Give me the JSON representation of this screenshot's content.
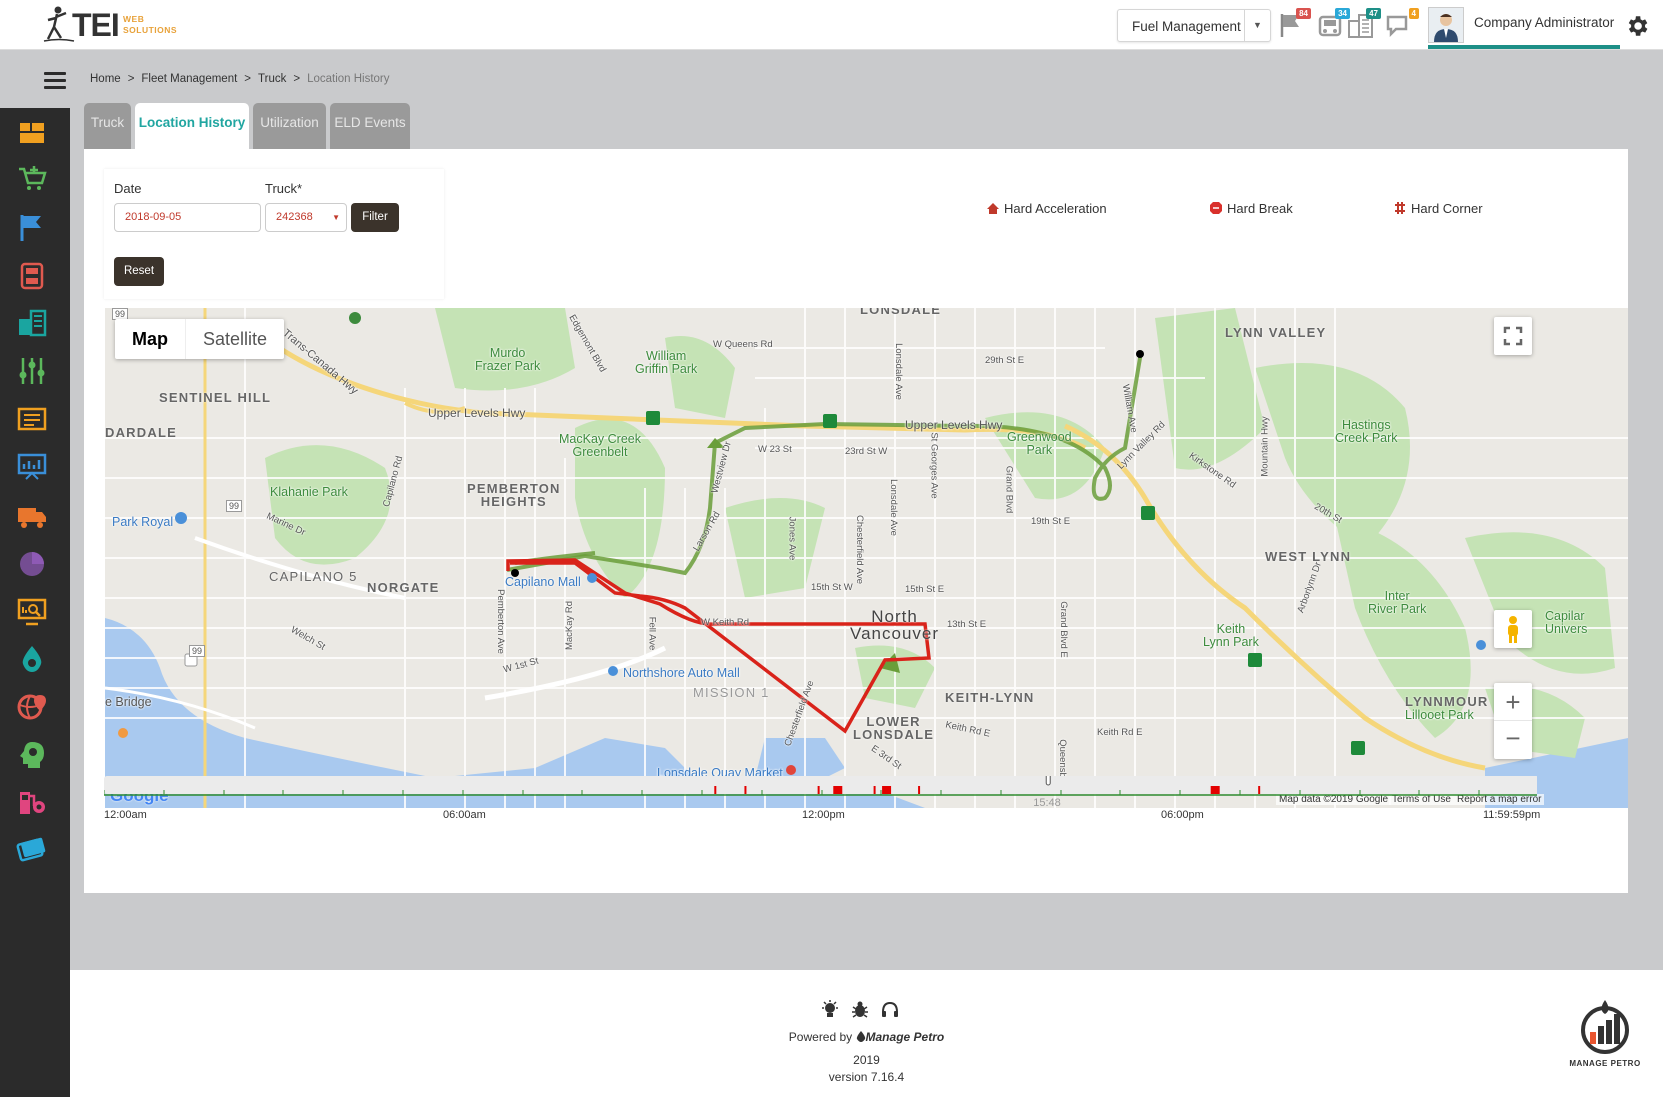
{
  "header": {
    "logo_main": "TEI",
    "logo_sub_1": "WEB",
    "logo_sub_2": "SOLUTIONS",
    "module_select": "Fuel Management",
    "notifications": [
      {
        "icon": "flag-icon",
        "count": "84",
        "color": "#d9534f"
      },
      {
        "icon": "fuel-pump-icon",
        "count": "34",
        "color": "#2aa8d8"
      },
      {
        "icon": "building-icon",
        "count": "47",
        "color": "#1d8f87"
      },
      {
        "icon": "chat-icon",
        "count": "4",
        "color": "#f0a020"
      }
    ],
    "user_name": "Company Administrator"
  },
  "sidebar": {
    "items": [
      {
        "icon": "dashboard-icon",
        "color": "#f0a020"
      },
      {
        "icon": "cart-icon",
        "color": "#5cb85c"
      },
      {
        "icon": "flag-icon",
        "color": "#3a8fd9"
      },
      {
        "icon": "fuel-station-icon",
        "color": "#e05a4f"
      },
      {
        "icon": "buildings-icon",
        "color": "#1aa5a0"
      },
      {
        "icon": "sliders-icon",
        "color": "#5cb85c"
      },
      {
        "icon": "report-icon",
        "color": "#f0a020"
      },
      {
        "icon": "presentation-chart-icon",
        "color": "#3a8fd9"
      },
      {
        "icon": "truck-icon",
        "color": "#e8762d"
      },
      {
        "icon": "pie-chart-icon",
        "color": "#8e5ab5"
      },
      {
        "icon": "monitor-search-icon",
        "color": "#f0a020"
      },
      {
        "icon": "water-drop-icon",
        "color": "#1aa5a0"
      },
      {
        "icon": "globe-pin-icon",
        "color": "#e05a4f"
      },
      {
        "icon": "gear-head-icon",
        "color": "#5cb85c"
      },
      {
        "icon": "pump-gear-icon",
        "color": "#e0457f"
      },
      {
        "icon": "card-icon",
        "color": "#2aa8d8"
      }
    ]
  },
  "breadcrumb": [
    "Home",
    "Fleet Management",
    "Truck",
    "Location History"
  ],
  "tabs": [
    {
      "label": "Truck",
      "active": false
    },
    {
      "label": "Location History",
      "active": true
    },
    {
      "label": "Utilization",
      "active": false
    },
    {
      "label": "ELD Events",
      "active": false
    }
  ],
  "filter": {
    "date_label": "Date",
    "date_value": "2018-09-05",
    "truck_label": "Truck*",
    "truck_value": "242368",
    "filter_button": "Filter",
    "reset_button": "Reset"
  },
  "legend": {
    "hard_acceleration": "Hard Acceleration",
    "hard_break": "Hard Break",
    "hard_corner": "Hard Corner"
  },
  "map": {
    "type_map": "Map",
    "type_satellite": "Satellite",
    "attribution": "Map data ©2019 Google",
    "terms": "Terms of Use",
    "report": "Report a map error",
    "google": "Google",
    "labels": {
      "lonsdale_top": "LONSDALE",
      "lynn_valley": "LYNN VALLEY",
      "sentinel_hill": "SENTINEL HILL",
      "ardale": "DARDALE",
      "pemberton_heights": "PEMBERTON\nHEIGHTS",
      "capilano5": "CAPILANO 5",
      "norgate": "NORGATE",
      "west_lynn": "WEST LYNN",
      "mission": "MISSION 1",
      "keith_lynn": "KEITH-LYNN",
      "lower_lonsdale": "LOWER\nLONSDALE",
      "lynnmour": "LYNNMOUR",
      "north_vancouver": "North\nVancouver",
      "murdo": "Murdo\nFrazer Park",
      "william": "William\nGriffin Park",
      "mackay": "MacKay Creek\nGreenbelt",
      "klahanie": "Klahanie Park",
      "greenwood": "Greenwood\nPark",
      "hastings": "Hastings\nCreek Park",
      "inter_river": "Inter\nRiver Park",
      "keith_lynn_park": "Keith\nLynn Park",
      "lillooet": "Lillooet Park",
      "capilano_univ": "Capilar\nUnivers",
      "park_royal": "Park Royal",
      "capilano_mall": "Capilano Mall",
      "northshore": "Northshore Auto Mall",
      "lonsdale_quay": "Lonsdale Quay Market",
      "bridge": "e Bridge",
      "upper_levels": "Upper Levels Hwy",
      "upper_levels_2": "Upper Levels Hwy",
      "trans_canada": "Trans-Canada Hwy",
      "w_queens": "W Queens Rd",
      "w23": "W 23 St",
      "e23": "23rd St W",
      "e29": "29th St E",
      "e19": "19th St E",
      "e20": "20th St",
      "w15": "15th St W",
      "e15": "15th St E",
      "e13": "13th St E",
      "keith_rd": "Keith Rd E",
      "keith_rd2": "Keith Rd E",
      "w1st": "W 1st St",
      "e3rd": "E 3rd St",
      "marine": "Marine Dr",
      "welch": "Welch St",
      "kirkstone": "Kirkstone Rd",
      "lynn_valley_rd": "Lynn Valley Rd",
      "capilano_rd": "Capilano Rd",
      "pemberton_ave": "Pemberton Ave",
      "mackay_rd": "MacKay Rd",
      "fell": "Fell Ave",
      "jones": "Jones Ave",
      "chesterfield": "Chesterfield Ave",
      "chesterfield2": "Chesterfield Ave",
      "lonsdale_ave": "Lonsdale Ave",
      "lonsdale_ave2": "Lonsdale Ave",
      "st_georges": "St Georges Ave",
      "grand_blvd": "Grand Blvd",
      "grand_blvd_e": "Grand Blvd E",
      "william_ave": "William Ave",
      "mountain_hwy": "Mountain Hwy",
      "arborlynn": "Arborlynn Dr",
      "larson": "Larson Rd",
      "westview": "Westview Dr",
      "edgemont": "Edgemont Blvd",
      "queensbury": "Queensb",
      "w_keith": "W Keith Rd",
      "hwy99a": "99",
      "hwy99b": "99",
      "hwy99c": "99"
    }
  },
  "timeline": {
    "labels": [
      "12:00am",
      "06:00am",
      "12:00pm",
      "06:00pm",
      "11:59:59pm"
    ],
    "cursor_time": "15:48",
    "cursor_fraction": 0.658,
    "events": [
      0.426,
      0.447,
      0.498,
      0.511,
      0.537,
      0.545,
      0.568,
      0.774,
      0.805
    ],
    "event_kinds": [
      "tick",
      "tick",
      "tick",
      "box",
      "tick",
      "box",
      "tick",
      "box",
      "tick"
    ]
  },
  "footer": {
    "powered_by": "Powered by",
    "brand": "Manage Petro",
    "year": "2019",
    "version": "version 7.16.4",
    "logo_text": "MANAGE PETRO"
  }
}
